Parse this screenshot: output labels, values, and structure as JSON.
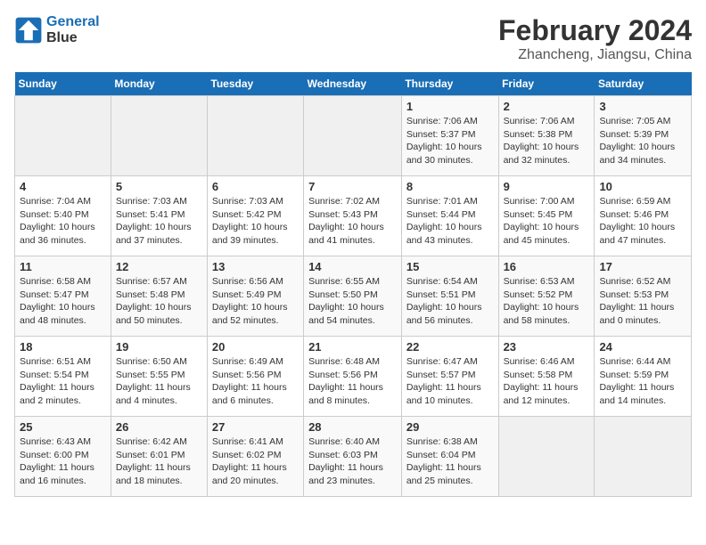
{
  "logo": {
    "line1": "General",
    "line2": "Blue"
  },
  "title": {
    "month_year": "February 2024",
    "location": "Zhancheng, Jiangsu, China"
  },
  "days_of_week": [
    "Sunday",
    "Monday",
    "Tuesday",
    "Wednesday",
    "Thursday",
    "Friday",
    "Saturday"
  ],
  "weeks": [
    [
      {
        "day": "",
        "content": ""
      },
      {
        "day": "",
        "content": ""
      },
      {
        "day": "",
        "content": ""
      },
      {
        "day": "",
        "content": ""
      },
      {
        "day": "1",
        "content": "Sunrise: 7:06 AM\nSunset: 5:37 PM\nDaylight: 10 hours and 30 minutes."
      },
      {
        "day": "2",
        "content": "Sunrise: 7:06 AM\nSunset: 5:38 PM\nDaylight: 10 hours and 32 minutes."
      },
      {
        "day": "3",
        "content": "Sunrise: 7:05 AM\nSunset: 5:39 PM\nDaylight: 10 hours and 34 minutes."
      }
    ],
    [
      {
        "day": "4",
        "content": "Sunrise: 7:04 AM\nSunset: 5:40 PM\nDaylight: 10 hours and 36 minutes."
      },
      {
        "day": "5",
        "content": "Sunrise: 7:03 AM\nSunset: 5:41 PM\nDaylight: 10 hours and 37 minutes."
      },
      {
        "day": "6",
        "content": "Sunrise: 7:03 AM\nSunset: 5:42 PM\nDaylight: 10 hours and 39 minutes."
      },
      {
        "day": "7",
        "content": "Sunrise: 7:02 AM\nSunset: 5:43 PM\nDaylight: 10 hours and 41 minutes."
      },
      {
        "day": "8",
        "content": "Sunrise: 7:01 AM\nSunset: 5:44 PM\nDaylight: 10 hours and 43 minutes."
      },
      {
        "day": "9",
        "content": "Sunrise: 7:00 AM\nSunset: 5:45 PM\nDaylight: 10 hours and 45 minutes."
      },
      {
        "day": "10",
        "content": "Sunrise: 6:59 AM\nSunset: 5:46 PM\nDaylight: 10 hours and 47 minutes."
      }
    ],
    [
      {
        "day": "11",
        "content": "Sunrise: 6:58 AM\nSunset: 5:47 PM\nDaylight: 10 hours and 48 minutes."
      },
      {
        "day": "12",
        "content": "Sunrise: 6:57 AM\nSunset: 5:48 PM\nDaylight: 10 hours and 50 minutes."
      },
      {
        "day": "13",
        "content": "Sunrise: 6:56 AM\nSunset: 5:49 PM\nDaylight: 10 hours and 52 minutes."
      },
      {
        "day": "14",
        "content": "Sunrise: 6:55 AM\nSunset: 5:50 PM\nDaylight: 10 hours and 54 minutes."
      },
      {
        "day": "15",
        "content": "Sunrise: 6:54 AM\nSunset: 5:51 PM\nDaylight: 10 hours and 56 minutes."
      },
      {
        "day": "16",
        "content": "Sunrise: 6:53 AM\nSunset: 5:52 PM\nDaylight: 10 hours and 58 minutes."
      },
      {
        "day": "17",
        "content": "Sunrise: 6:52 AM\nSunset: 5:53 PM\nDaylight: 11 hours and 0 minutes."
      }
    ],
    [
      {
        "day": "18",
        "content": "Sunrise: 6:51 AM\nSunset: 5:54 PM\nDaylight: 11 hours and 2 minutes."
      },
      {
        "day": "19",
        "content": "Sunrise: 6:50 AM\nSunset: 5:55 PM\nDaylight: 11 hours and 4 minutes."
      },
      {
        "day": "20",
        "content": "Sunrise: 6:49 AM\nSunset: 5:56 PM\nDaylight: 11 hours and 6 minutes."
      },
      {
        "day": "21",
        "content": "Sunrise: 6:48 AM\nSunset: 5:56 PM\nDaylight: 11 hours and 8 minutes."
      },
      {
        "day": "22",
        "content": "Sunrise: 6:47 AM\nSunset: 5:57 PM\nDaylight: 11 hours and 10 minutes."
      },
      {
        "day": "23",
        "content": "Sunrise: 6:46 AM\nSunset: 5:58 PM\nDaylight: 11 hours and 12 minutes."
      },
      {
        "day": "24",
        "content": "Sunrise: 6:44 AM\nSunset: 5:59 PM\nDaylight: 11 hours and 14 minutes."
      }
    ],
    [
      {
        "day": "25",
        "content": "Sunrise: 6:43 AM\nSunset: 6:00 PM\nDaylight: 11 hours and 16 minutes."
      },
      {
        "day": "26",
        "content": "Sunrise: 6:42 AM\nSunset: 6:01 PM\nDaylight: 11 hours and 18 minutes."
      },
      {
        "day": "27",
        "content": "Sunrise: 6:41 AM\nSunset: 6:02 PM\nDaylight: 11 hours and 20 minutes."
      },
      {
        "day": "28",
        "content": "Sunrise: 6:40 AM\nSunset: 6:03 PM\nDaylight: 11 hours and 23 minutes."
      },
      {
        "day": "29",
        "content": "Sunrise: 6:38 AM\nSunset: 6:04 PM\nDaylight: 11 hours and 25 minutes."
      },
      {
        "day": "",
        "content": ""
      },
      {
        "day": "",
        "content": ""
      }
    ]
  ]
}
